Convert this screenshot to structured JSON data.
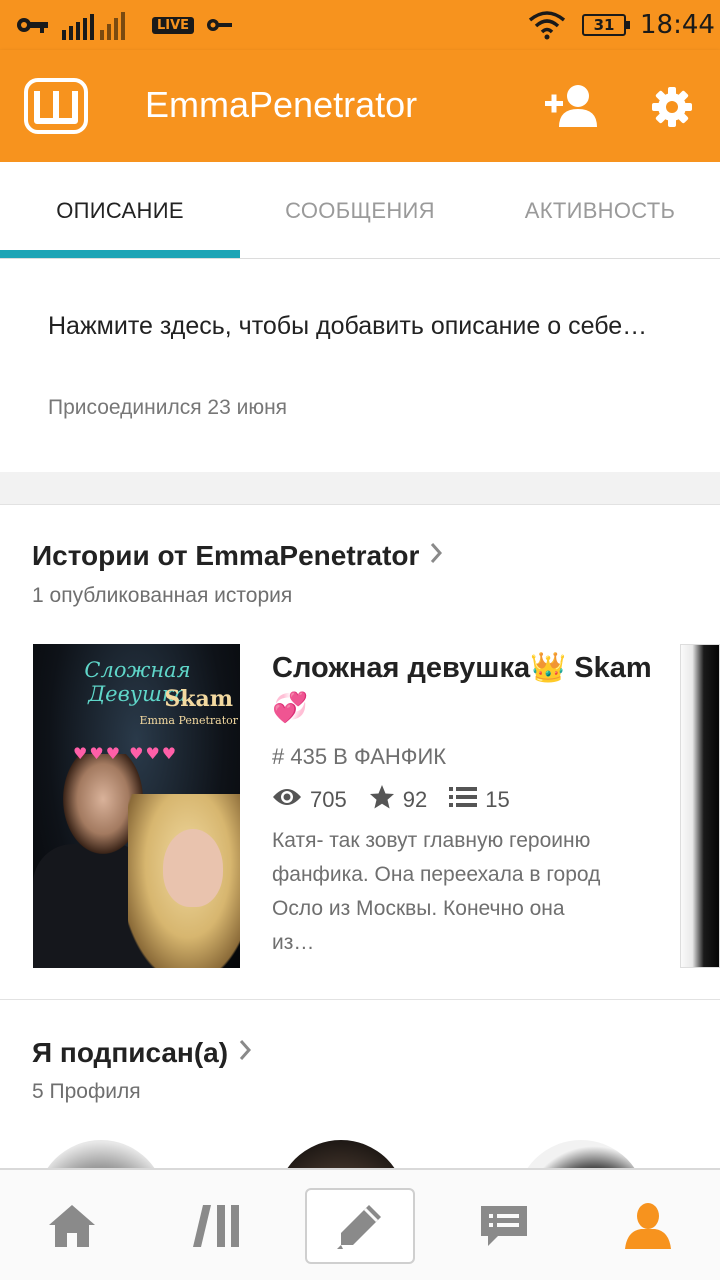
{
  "status_bar": {
    "live_badge": "LIVE",
    "battery": "31",
    "time": "18:44"
  },
  "app_bar": {
    "title": "EmmaPenetrator",
    "logo_letter": "ш",
    "icons": [
      "wattpad-logo-icon",
      "add-user-icon",
      "settings-gear-icon"
    ]
  },
  "tabs": [
    {
      "label": "ОПИСАНИЕ",
      "active": true
    },
    {
      "label": "СООБЩЕНИЯ",
      "active": false
    },
    {
      "label": "АКТИВНОСТЬ",
      "active": false
    }
  ],
  "profile": {
    "description_placeholder": "Нажмите здесь, чтобы добавить описание о себе…",
    "joined": "Присоединился 23 июня"
  },
  "stories_section": {
    "title": "Истории от EmmaPenetrator",
    "count": "1 опубликованная история",
    "story": {
      "cover_title": "Сложная Девушка",
      "cover_subtitle": "Skam",
      "cover_author": "Emma Penetrator",
      "title": "Сложная девушка👑 Skam💞",
      "rank": "# 435 В ФАНФИК",
      "reads": "705",
      "votes": "92",
      "parts": "15",
      "blurb": "Катя- так зовут главную героиню фанфика. Она переехала в город Осло из Москвы. Конечно она из…"
    }
  },
  "following_section": {
    "title": "Я подписан(а)",
    "count": "5 Профиля"
  },
  "bottom_nav": {
    "items": [
      "home-icon",
      "library-icon",
      "write-icon",
      "messages-icon",
      "profile-icon"
    ],
    "active": "profile-icon"
  },
  "colors": {
    "brand_orange": "#f7931e",
    "tab_indicator": "#1ea4b5",
    "nav_active": "#f7931e",
    "nav_inactive": "#8a8a8a"
  }
}
